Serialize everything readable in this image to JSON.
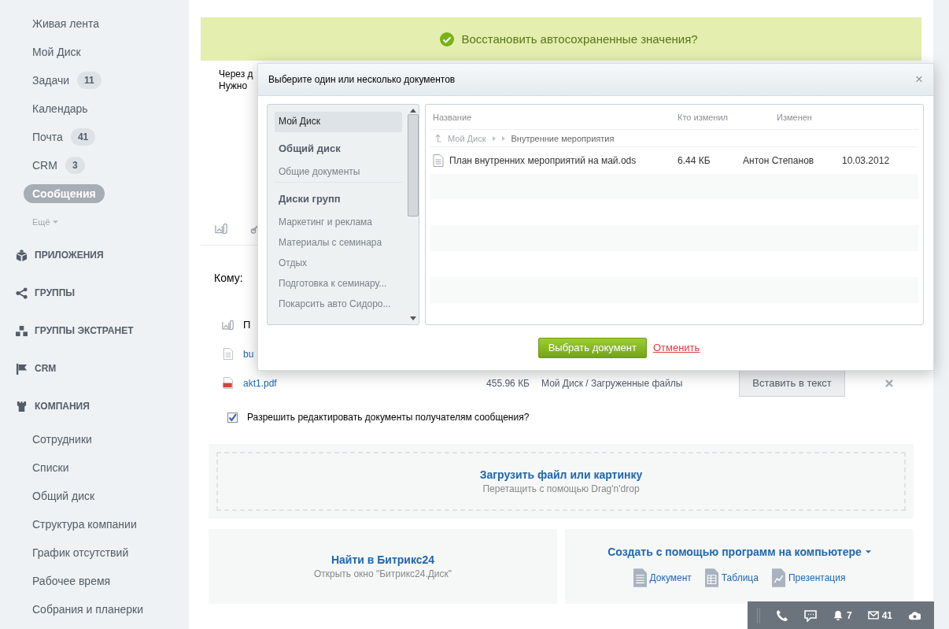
{
  "sidebar": {
    "items": [
      {
        "label": "Живая лента",
        "selected": false
      },
      {
        "label": "Мой Диск",
        "selected": false
      },
      {
        "label": "Задачи",
        "counter": "11",
        "selected": false
      },
      {
        "label": "Календарь",
        "selected": false
      },
      {
        "label": "Почта",
        "counter": "41",
        "selected": false
      },
      {
        "label": "CRM",
        "counter": "3",
        "selected": false
      },
      {
        "label": "Сообщения",
        "selected": true
      }
    ],
    "more": "Ещё",
    "sections": [
      {
        "label": "ПРИЛОЖЕНИЯ"
      },
      {
        "label": "ГРУППЫ"
      },
      {
        "label": "ГРУППЫ ЭКСТРАНЕТ"
      },
      {
        "label": "CRM"
      },
      {
        "label": "КОМПАНИЯ",
        "children": [
          {
            "label": "Сотрудники"
          },
          {
            "label": "Списки"
          },
          {
            "label": "Общий диск"
          },
          {
            "label": "Структура компании"
          },
          {
            "label": "График отсутствий"
          },
          {
            "label": "Рабочее время"
          },
          {
            "label": "Собрания и планерки"
          }
        ]
      }
    ]
  },
  "banner": {
    "text": "Восстановить автосохраненные значения?"
  },
  "editor": {
    "lines": [
      "Через д",
      "Нужно"
    ]
  },
  "recipients_label": "Кому:",
  "attachments": {
    "header": "П",
    "files": [
      {
        "kind": "doc",
        "name": "bu"
      },
      {
        "kind": "pdf",
        "name": "akt1.pdf",
        "size": "455.96 КБ",
        "location": "Мой Диск / Загруженные файлы",
        "action": "Вставить в текст"
      }
    ]
  },
  "allow_edit": {
    "label": "Разрешить редактировать документы получателям сообщения?",
    "checked": true
  },
  "upload": {
    "title": "Загрузить файл или картинку",
    "hint": "Перетащить с помощью Drag'n'drop"
  },
  "find": {
    "title": "Найти в Битрикс24",
    "hint": "Открыть окно \"Битрикс24.Диск\""
  },
  "create": {
    "title": "Создать с помощью программ на компьютере",
    "options": [
      {
        "label": "Документ"
      },
      {
        "label": "Таблица"
      },
      {
        "label": "Презентация"
      }
    ]
  },
  "dialog": {
    "title": "Выберите один или несколько документов",
    "close": "×",
    "tree": [
      {
        "kind": "item",
        "label": "Мой Диск",
        "selected": true
      },
      {
        "kind": "heading",
        "label": "Общий диск"
      },
      {
        "kind": "item",
        "label": "Общие документы",
        "selected": false
      },
      {
        "kind": "heading",
        "label": "Диски групп"
      },
      {
        "kind": "item",
        "label": "Маркетинг и реклама",
        "selected": false
      },
      {
        "kind": "item",
        "label": "Материалы с семинара",
        "selected": false
      },
      {
        "kind": "item",
        "label": "Отдых",
        "selected": false
      },
      {
        "kind": "item",
        "label": "Подготовка к семинару...",
        "selected": false
      },
      {
        "kind": "item",
        "label": "Покарсить авто Сидоро...",
        "selected": false
      }
    ],
    "columns": [
      "Название",
      "Кто изменил",
      "Изменен"
    ],
    "breadcrumb": [
      "Мой Диск",
      "Внутренние мероприятия"
    ],
    "rows": [
      {
        "name": "План внутренних мероприятий на май.ods",
        "size": "6.44 КБ",
        "author": "Антон Степанов",
        "date": "10.03.2012"
      }
    ],
    "confirm": "Выбрать документ",
    "cancel": "Отменить"
  },
  "status_bar": {
    "notifications": "7",
    "messages": "41"
  }
}
